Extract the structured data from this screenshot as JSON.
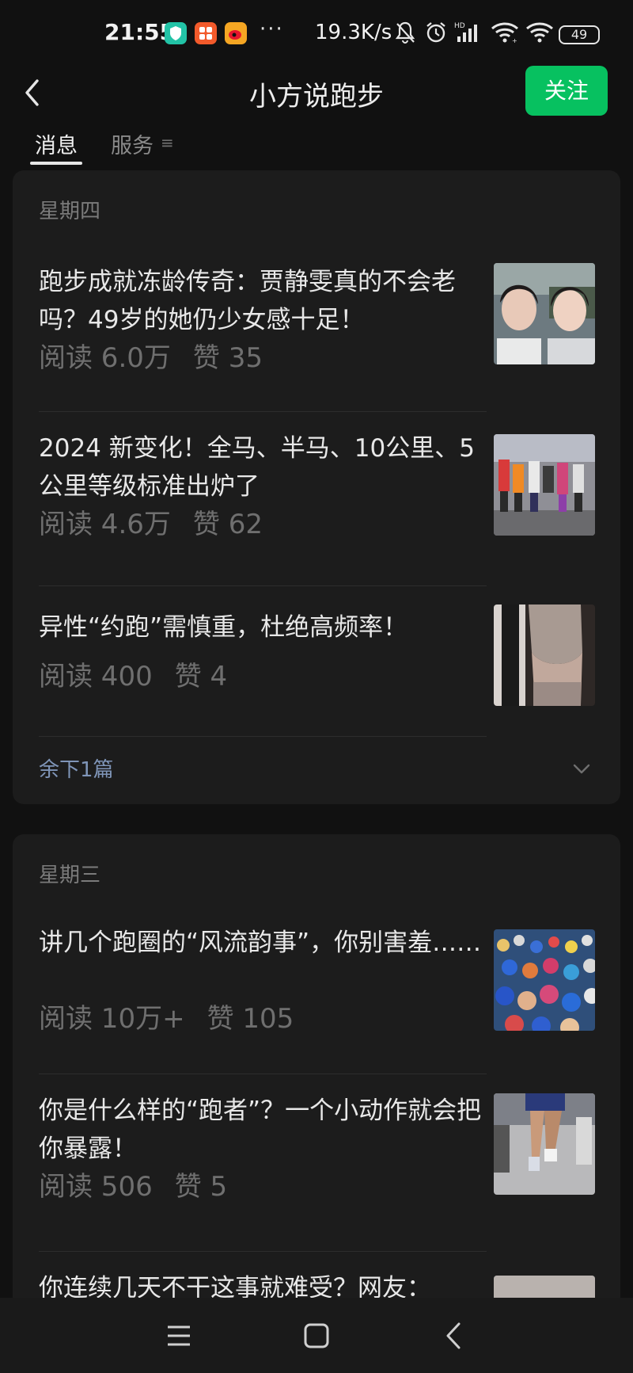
{
  "status_bar": {
    "time": "21:55",
    "app_icons": [
      {
        "name": "shield-app-icon",
        "color": "#22c3a6"
      },
      {
        "name": "photo-app-icon",
        "color": "#f25a2b"
      },
      {
        "name": "weibo-app-icon",
        "color": "#f5a623"
      }
    ],
    "more": "···",
    "net_speed": "19.3K/s",
    "battery": "49"
  },
  "header": {
    "title": "小方说跑步",
    "follow_label": "关注",
    "accent": "#07c160"
  },
  "tabs": [
    {
      "label": "消息",
      "active": true
    },
    {
      "label": "服务",
      "active": false
    }
  ],
  "groups": [
    {
      "day": "星期四",
      "articles": [
        {
          "title": "跑步成就冻龄传奇：贾静雯真的不会老吗？49岁的她仍少女感十足！",
          "reads": "阅读 6.0万",
          "likes": "赞 35",
          "thumb": "two-women-selfie"
        },
        {
          "title": "2024 新变化！全马、半马、10公里、5公里等级标准出炉了",
          "reads": "阅读 4.6万",
          "likes": "赞 62",
          "thumb": "marathon-runners"
        },
        {
          "title": "异性“约跑”需慎重，杜绝高频率！",
          "reads": "阅读 400",
          "likes": "赞 4",
          "thumb": "fitness-woman"
        }
      ],
      "more_label": "余下1篇"
    },
    {
      "day": "星期三",
      "articles": [
        {
          "title": "讲几个跑圈的“风流韵事”，你别害羞……",
          "reads": "阅读 10万+",
          "likes": "赞 105",
          "thumb": "crowd-runners"
        },
        {
          "title": "你是什么样的“跑者”？一个小动作就会把你暴露！",
          "reads": "阅读 506",
          "likes": "赞 5",
          "thumb": "runner-legs"
        },
        {
          "title": "你连续几天不干这事就难受？网友：",
          "reads": "",
          "likes": "",
          "thumb": "partial-photo"
        }
      ]
    }
  ],
  "nav": {
    "menu": "menu-icon",
    "home": "home-square-icon",
    "back": "back-triangle-icon"
  }
}
